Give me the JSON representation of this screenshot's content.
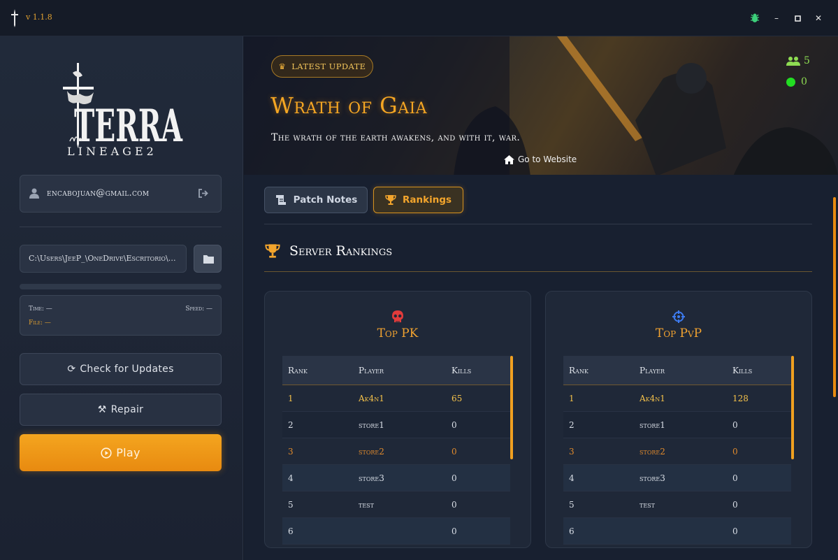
{
  "titlebar": {
    "version": "v 1.1.8",
    "icons": [
      "sword-logo-icon",
      "bug-icon",
      "minimize-icon",
      "maximize-icon",
      "close-icon"
    ]
  },
  "sidebar": {
    "logo_text": "TERRA",
    "logo_sub": "LINEAGE2",
    "email": "encabojuan@gmail.com",
    "install_path": "C:\\Users\\JeeP_\\OneDrive\\Escritorio\\L...",
    "stats": {
      "time_label": "Time: —",
      "speed_label": "Speed: —",
      "file_label": "File: —"
    },
    "check_updates_label": "Check for Updates",
    "repair_label": "Repair",
    "play_label": "Play"
  },
  "banner": {
    "badge": "LATEST UPDATE",
    "title": "Wrath of Gaia",
    "subtitle": "The wrath of the earth awakens, and with it, war.",
    "link_label": "Go to Website",
    "players_count": "5",
    "status_count": "0",
    "colors": {
      "accent": "#f5a623",
      "online": "#22dd22",
      "players": "#8edc52"
    }
  },
  "tabs": [
    {
      "label": "Patch Notes",
      "active": false
    },
    {
      "label": "Rankings",
      "active": true
    }
  ],
  "section_title": "Server Rankings",
  "rankings": {
    "pk": {
      "title": "Top PK",
      "headers": [
        "Rank",
        "Player",
        "Kills"
      ],
      "rows": [
        {
          "rank": "1",
          "player": "Ak4n1",
          "kills": "65"
        },
        {
          "rank": "2",
          "player": "store1",
          "kills": "0"
        },
        {
          "rank": "3",
          "player": "store2",
          "kills": "0"
        },
        {
          "rank": "4",
          "player": "store3",
          "kills": "0"
        },
        {
          "rank": "5",
          "player": "test",
          "kills": "0"
        },
        {
          "rank": "6",
          "player": "",
          "kills": "0"
        }
      ]
    },
    "pvp": {
      "title": "Top PvP",
      "headers": [
        "Rank",
        "Player",
        "Kills"
      ],
      "rows": [
        {
          "rank": "1",
          "player": "Ak4n1",
          "kills": "128"
        },
        {
          "rank": "2",
          "player": "store1",
          "kills": "0"
        },
        {
          "rank": "3",
          "player": "store2",
          "kills": "0"
        },
        {
          "rank": "4",
          "player": "store3",
          "kills": "0"
        },
        {
          "rank": "5",
          "player": "test",
          "kills": "0"
        },
        {
          "rank": "6",
          "player": "",
          "kills": "0"
        }
      ]
    }
  }
}
